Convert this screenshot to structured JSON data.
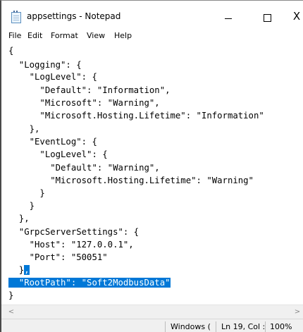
{
  "window": {
    "title": "appsettings - Notepad",
    "controls": {
      "minimize": "",
      "maximize": "",
      "close": "X"
    }
  },
  "menu": [
    "File",
    "Edit",
    "Format",
    "View",
    "Help"
  ],
  "editor": {
    "lines": [
      "{",
      "  \"Logging\": {",
      "    \"LogLevel\": {",
      "      \"Default\": \"Information\",",
      "      \"Microsoft\": \"Warning\",",
      "      \"Microsoft.Hosting.Lifetime\": \"Information\"",
      "    },",
      "    \"EventLog\": {",
      "      \"LogLevel\": {",
      "        \"Default\": \"Warning\",",
      "        \"Microsoft.Hosting.Lifetime\": \"Warning\"",
      "      }",
      "    }",
      "  },",
      "  \"GrpcServerSettings\": {",
      "    \"Host\": \"127.0.0.1\",",
      "    \"Port\": \"50051\"",
      "  }",
      "  \"RootPath\": \"Soft2ModbusData\"",
      "}"
    ],
    "line17_plain": "  }",
    "line17_selected": ",",
    "selection_color": "#0078d7"
  },
  "status": {
    "encoding": "Windows (",
    "position": "Ln 19, Col :",
    "zoom": "100%"
  },
  "scrollbar": {
    "left_arrow": "<",
    "right_arrow": ">"
  }
}
